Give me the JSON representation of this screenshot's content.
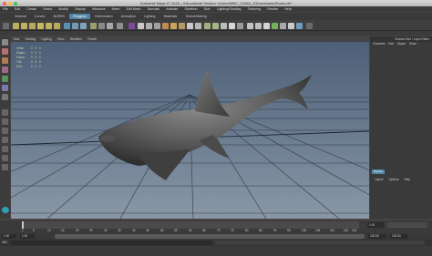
{
  "window": {
    "title": "Autodesk Maya LT 2015 – Educational Version: /Users/MMC_CDMA_3/Downloads/Shark.mlt*"
  },
  "menubar": [
    "File",
    "Edit",
    "Create",
    "Select",
    "Modify",
    "Display",
    "Windows",
    "Mesh",
    "Edit Mesh",
    "Normals",
    "Animate",
    "Skeleton",
    "Skin",
    "Lighting/Shading",
    "Texturing",
    "Render",
    "Help"
  ],
  "shelf": {
    "tabs": [
      "General",
      "Curves",
      "NURBS",
      "Polygons",
      "Deformation",
      "Animation",
      "Lighting",
      "Materials",
      "TextureMaking"
    ],
    "active_index": 3
  },
  "viewport": {
    "menu": [
      "View",
      "Shading",
      "Lighting",
      "Show",
      "Renderer",
      "Panels"
    ],
    "hud": [
      {
        "label": "Verts:",
        "values": [
          "0",
          "0",
          "0"
        ]
      },
      {
        "label": "Edges:",
        "values": [
          "0",
          "0",
          "0"
        ]
      },
      {
        "label": "Faces:",
        "values": [
          "0",
          "0",
          "0"
        ]
      },
      {
        "label": "Tris:",
        "values": [
          "0",
          "0",
          "0"
        ]
      },
      {
        "label": "UVs:",
        "values": [
          "0",
          "0",
          "0"
        ]
      }
    ]
  },
  "channel_box": {
    "header": "Channel Box / Layer Editor",
    "menu": [
      "Channels",
      "Edit",
      "Object",
      "Show"
    ],
    "display_tab": "Display",
    "layer_menu": [
      "Layers",
      "Options",
      "Help"
    ]
  },
  "timeline": {
    "tick_labels": [
      "1",
      "5",
      "10",
      "15",
      "20",
      "25",
      "30",
      "35",
      "40",
      "45",
      "50",
      "55",
      "60",
      "65",
      "70",
      "75",
      "80",
      "85",
      "90",
      "95",
      "100",
      "105",
      "110",
      "115",
      "120"
    ],
    "current_frame": "1.00"
  },
  "range": {
    "start": "1.00",
    "start_inner": "1.00",
    "end_inner": "120.00",
    "end": "120.00"
  },
  "command_line": {
    "label": "MEL"
  },
  "colors": {
    "accent": "#5285a6",
    "hud_text": "#cfd8a0"
  }
}
